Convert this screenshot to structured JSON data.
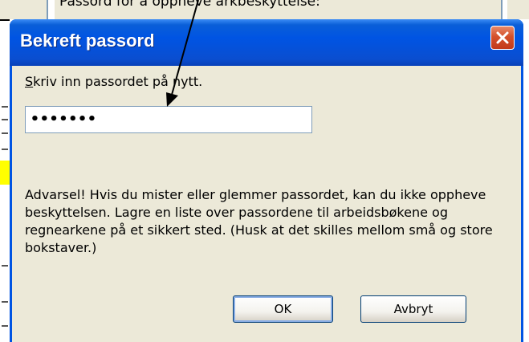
{
  "background": {
    "parent_dialog_text": "Passord for å oppheve arkbeskyttelse:"
  },
  "dialog": {
    "title": "Bekreft passord",
    "close_icon": "close-icon",
    "prompt_accesskey": "S",
    "prompt_rest": "kriv inn passordet på nytt.",
    "password_value": "•••••••",
    "warning": "Advarsel! Hvis du mister eller glemmer passordet, kan du ikke oppheve beskyttelsen. Lagre en liste over passordene til arbeidsbøkene og regnearkene på et sikkert sted. (Husk at det skilles mellom små og store bokstaver.)",
    "ok_label": "OK",
    "cancel_label": "Avbryt"
  },
  "colors": {
    "titlebar": "#0054e3",
    "client": "#ece9d8",
    "close_button": "#d4502a"
  }
}
